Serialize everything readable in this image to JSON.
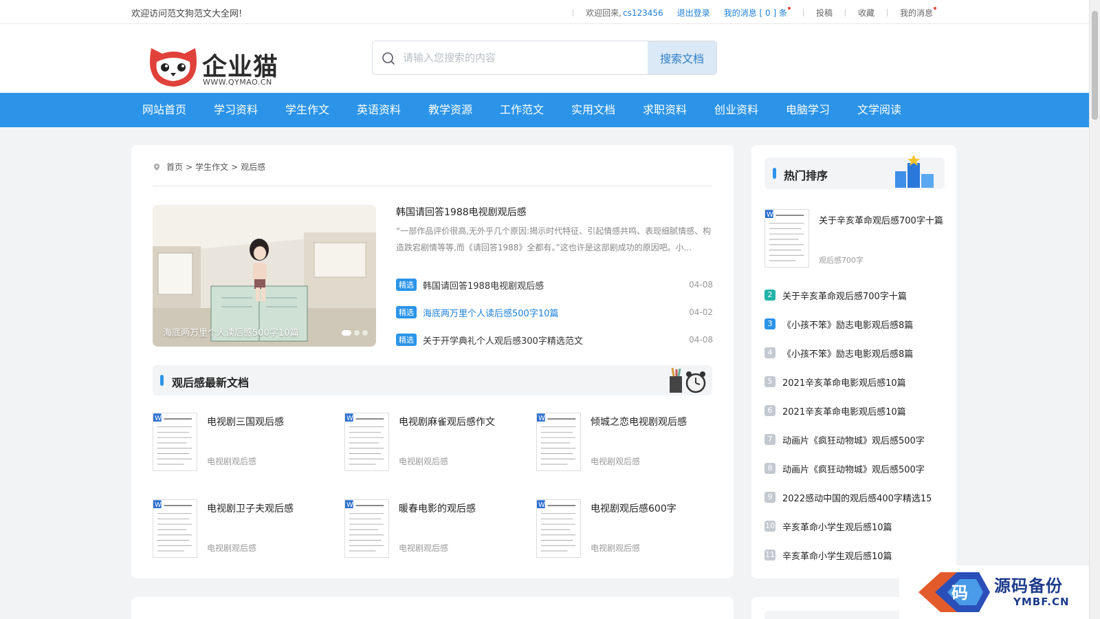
{
  "topbar": {
    "welcome": "欢迎访问范文狗范文大全网!",
    "greeting": "欢迎回来,",
    "username": "cs123456",
    "logout": "退出登录",
    "messages": "我的消息 [ 0 ] 条",
    "submit": "投稿",
    "favorites": "收藏",
    "my_messages": "我的消息"
  },
  "logo": {
    "name": "企业猫",
    "url": "WWW.QYMAO.CN"
  },
  "search": {
    "placeholder": "请输入您搜索的内容",
    "button": "搜索文档"
  },
  "nav": [
    "网站首页",
    "学习资料",
    "学生作文",
    "英语资料",
    "教学资源",
    "工作范文",
    "实用文档",
    "求职资料",
    "创业资料",
    "电脑学习",
    "文学阅读"
  ],
  "breadcrumb": {
    "home": "首页",
    "sep1": ">",
    "level1": "学生作文",
    "sep2": ">",
    "level2": "观后感"
  },
  "slider": {
    "caption": "海底两万里个人读后感500字10篇"
  },
  "featured": {
    "title": "韩国请回答1988电视剧观后感",
    "description": "“一部作品评价很高,无外乎几个原因:揭示时代特征、引起情感共鸣、表现细腻情感、构造跌宕剧情等等,而《请回答1988》全都有。”这也许是这部剧成功的原因吧。小..."
  },
  "picks": [
    {
      "tag": "精选",
      "title": "韩国请回答1988电视剧观后感",
      "date": "04-08"
    },
    {
      "tag": "精选",
      "title": "海底两万里个人读后感500字10篇",
      "date": "04-02"
    },
    {
      "tag": "精选",
      "title": "关于开学典礼个人观后感300字精选范文",
      "date": "04-08"
    }
  ],
  "latest": {
    "title": "观后感最新文档",
    "docs": [
      {
        "name": "电视剧三国观后感",
        "category": "电视剧观后感"
      },
      {
        "name": "电视剧麻雀观后感作文",
        "category": "电视剧观后感"
      },
      {
        "name": "倾城之恋电视剧观后感",
        "category": "电视剧观后感"
      },
      {
        "name": "电视剧卫子夫观后感",
        "category": "电视剧观后感"
      },
      {
        "name": "暖春电影的观后感",
        "category": "电视剧观后感"
      },
      {
        "name": "电视剧观后感600字",
        "category": "电视剧观后感"
      }
    ]
  },
  "hot": {
    "title": "热门排序",
    "first": {
      "name": "关于辛亥革命观后感700字十篇",
      "category": "观后感700字"
    },
    "items": [
      {
        "rank": "2",
        "title": "关于辛亥革命观后感700字十篇",
        "color": "#22b3a8"
      },
      {
        "rank": "3",
        "title": "《小孩不笨》励志电影观后感8篇",
        "color": "#2b94e8"
      },
      {
        "rank": "4",
        "title": "《小孩不笨》励志电影观后感8篇",
        "color": "#c4c9d0"
      },
      {
        "rank": "5",
        "title": "2021辛亥革命电影观后感10篇",
        "color": "#c4c9d0"
      },
      {
        "rank": "6",
        "title": "2021辛亥革命电影观后感10篇",
        "color": "#c4c9d0"
      },
      {
        "rank": "7",
        "title": "动画片《疯狂动物城》观后感500字",
        "color": "#c4c9d0"
      },
      {
        "rank": "8",
        "title": "动画片《疯狂动物城》观后感500字",
        "color": "#c4c9d0"
      },
      {
        "rank": "9",
        "title": "2022感动中国的观后感400字精选15",
        "color": "#c4c9d0"
      },
      {
        "rank": "10",
        "title": "辛亥革命小学生观后感10篇",
        "color": "#c4c9d0"
      },
      {
        "rank": "11",
        "title": "辛亥革命小学生观后感10篇",
        "color": "#c4c9d0"
      }
    ]
  },
  "watermark": {
    "cn": "源码备份",
    "en": "YMBF.CN",
    "badge": "码"
  },
  "colors": {
    "primary": "#2b94e8",
    "link": "#1b7fd9",
    "logo_red": "#e0413a"
  }
}
